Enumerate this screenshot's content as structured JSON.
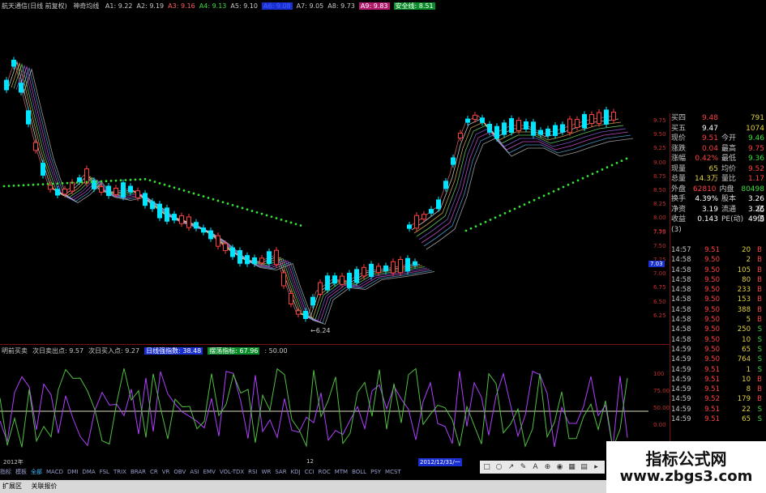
{
  "header": {
    "title": "航天通信(日线 前复权)",
    "indicator": "神奇均线",
    "ma": [
      {
        "label": "A1: 9.22",
        "color": "#c8c8c8"
      },
      {
        "label": "A2: 9.19",
        "color": "#c8c8c8"
      },
      {
        "label": "A3: 9.16",
        "color": "#ff6060"
      },
      {
        "label": "A4: 9.13",
        "color": "#3cdc3c"
      },
      {
        "label": "A5: 9.10",
        "color": "#c8c8c8"
      },
      {
        "label": "A6: 9.08",
        "color": "#4060ff",
        "style": "blue"
      },
      {
        "label": "A7: 9.05",
        "color": "#c8c8c8"
      },
      {
        "label": "A8: 9.73",
        "color": "#c8c8c8"
      },
      {
        "label": "A9: 9.83",
        "color": "#fff",
        "style": "pink"
      },
      {
        "label": "安全线: 8.51",
        "color": "#fff",
        "style": "green"
      }
    ]
  },
  "main_chart": {
    "low_annotation": "6.24",
    "right_axis": [
      "9.75",
      "9.50",
      "9.25",
      "9.00",
      "8.75",
      "8.50",
      "8.25",
      "8.00",
      "7.75",
      "7.50",
      "7.25",
      "7.00",
      "6.75",
      "6.50",
      "6.25"
    ],
    "current_price_tag": "7.03",
    "mid_price_tag": "7.50"
  },
  "osc_header": {
    "items": [
      {
        "label": "明前买卖",
        "color": "#c8c8c8"
      },
      {
        "label": "次日卖出点: 9.57",
        "color": "#c8c8c8"
      },
      {
        "label": "次日买入点: 9.27",
        "color": "#c8c8c8"
      },
      {
        "label": "日线强指数: 38.48",
        "color": "#fff",
        "style": "blue"
      },
      {
        "label": "摆荡指标: 67.96",
        "color": "#fff",
        "style": "green"
      },
      {
        "label": ": 50.00",
        "color": "#c8c8c8"
      }
    ]
  },
  "osc_axis": [
    "100",
    "75.00",
    "50.00",
    "0.00"
  ],
  "quote": {
    "rows": [
      {
        "k": "买四",
        "v": "9.48",
        "vc": "red",
        "k2": "",
        "v2": "791",
        "v2c": "yellow"
      },
      {
        "k": "买五",
        "v": "9.47",
        "vc": "white",
        "k2": "",
        "v2": "1074",
        "v2c": "yellow"
      },
      {
        "k": "现价",
        "v": "9.51",
        "vc": "red",
        "k2": "今开",
        "v2": "9.46",
        "v2c": "green"
      },
      {
        "k": "涨跌",
        "v": "0.04",
        "vc": "red",
        "k2": "最高",
        "v2": "9.75",
        "v2c": "red"
      },
      {
        "k": "涨幅",
        "v": "0.42%",
        "vc": "red",
        "k2": "最低",
        "v2": "9.36",
        "v2c": "green"
      },
      {
        "k": "现量",
        "v": "65",
        "vc": "yellow",
        "k2": "均价",
        "v2": "9.52",
        "v2c": "red"
      },
      {
        "k": "总量",
        "v": "14.3万",
        "vc": "yellow",
        "k2": "量比",
        "v2": "1.17",
        "v2c": "red"
      },
      {
        "k": "外盘",
        "v": "62810",
        "vc": "red",
        "k2": "内盘",
        "v2": "80498",
        "v2c": "green"
      },
      {
        "k": "换手",
        "v": "4.39%",
        "vc": "white",
        "k2": "股本",
        "v2": "3.26亿",
        "v2c": "white"
      },
      {
        "k": "净资",
        "v": "3.19",
        "vc": "white",
        "k2": "流通",
        "v2": "3.26亿",
        "v2c": "white"
      },
      {
        "k": "收益(3)",
        "v": "0.143",
        "vc": "white",
        "k2": "PE(动)",
        "v2": "49.9",
        "v2c": "white"
      }
    ]
  },
  "trades": [
    {
      "t": "14:57",
      "p": "9.51",
      "v": "20",
      "s": "B"
    },
    {
      "t": "14:58",
      "p": "9.50",
      "v": "2",
      "s": "B"
    },
    {
      "t": "14:58",
      "p": "9.50",
      "v": "105",
      "s": "B"
    },
    {
      "t": "14:58",
      "p": "9.50",
      "v": "80",
      "s": "B"
    },
    {
      "t": "14:58",
      "p": "9.50",
      "v": "233",
      "s": "B"
    },
    {
      "t": "14:58",
      "p": "9.50",
      "v": "153",
      "s": "B"
    },
    {
      "t": "14:58",
      "p": "9.50",
      "v": "388",
      "s": "B"
    },
    {
      "t": "14:58",
      "p": "9.50",
      "v": "5",
      "s": "B"
    },
    {
      "t": "14:58",
      "p": "9.50",
      "v": "250",
      "s": "S"
    },
    {
      "t": "14:58",
      "p": "9.50",
      "v": "10",
      "s": "S"
    },
    {
      "t": "14:59",
      "p": "9.50",
      "v": "65",
      "s": "S"
    },
    {
      "t": "14:59",
      "p": "9.50",
      "v": "764",
      "s": "S"
    },
    {
      "t": "14:59",
      "p": "9.51",
      "v": "1",
      "s": "S"
    },
    {
      "t": "14:59",
      "p": "9.51",
      "v": "10",
      "s": "B"
    },
    {
      "t": "14:59",
      "p": "9.51",
      "v": "8",
      "s": "B"
    },
    {
      "t": "14:59",
      "p": "9.52",
      "v": "179",
      "s": "B"
    },
    {
      "t": "14:59",
      "p": "9.51",
      "v": "22",
      "s": "S"
    },
    {
      "t": "14:59",
      "p": "9.51",
      "v": "65",
      "s": "S"
    }
  ],
  "time_axis": {
    "left": "2012年",
    "mid": "12",
    "cursor_date": "2012/12/31/一"
  },
  "tabs": [
    "指标",
    "模板",
    "全部",
    "MACD",
    "DMI",
    "DMA",
    "FSL",
    "TRIX",
    "BRAR",
    "CR",
    "VR",
    "OBV",
    "ASI",
    "EMV",
    "VOL-TDX",
    "RSI",
    "WR",
    "SAR",
    "KDJ",
    "CCI",
    "ROC",
    "MTM",
    "BOLL",
    "PSY",
    "MCST"
  ],
  "footer": {
    "left": "扩展区",
    "right": "关联报价"
  },
  "toolbar_icons": [
    "square-icon",
    "circle-icon",
    "arrow-icon",
    "brush-icon",
    "text-icon",
    "pin-icon",
    "globe-icon",
    "grid-icon",
    "chart-icon",
    "export-icon"
  ],
  "watermark": {
    "title": "指标公式网",
    "url": "www.zbgs3.com"
  },
  "colors": {
    "up": "#ff4040",
    "down": "#00e5ff",
    "grid": "#7a1010",
    "safe_line": "#3cdc3c"
  }
}
